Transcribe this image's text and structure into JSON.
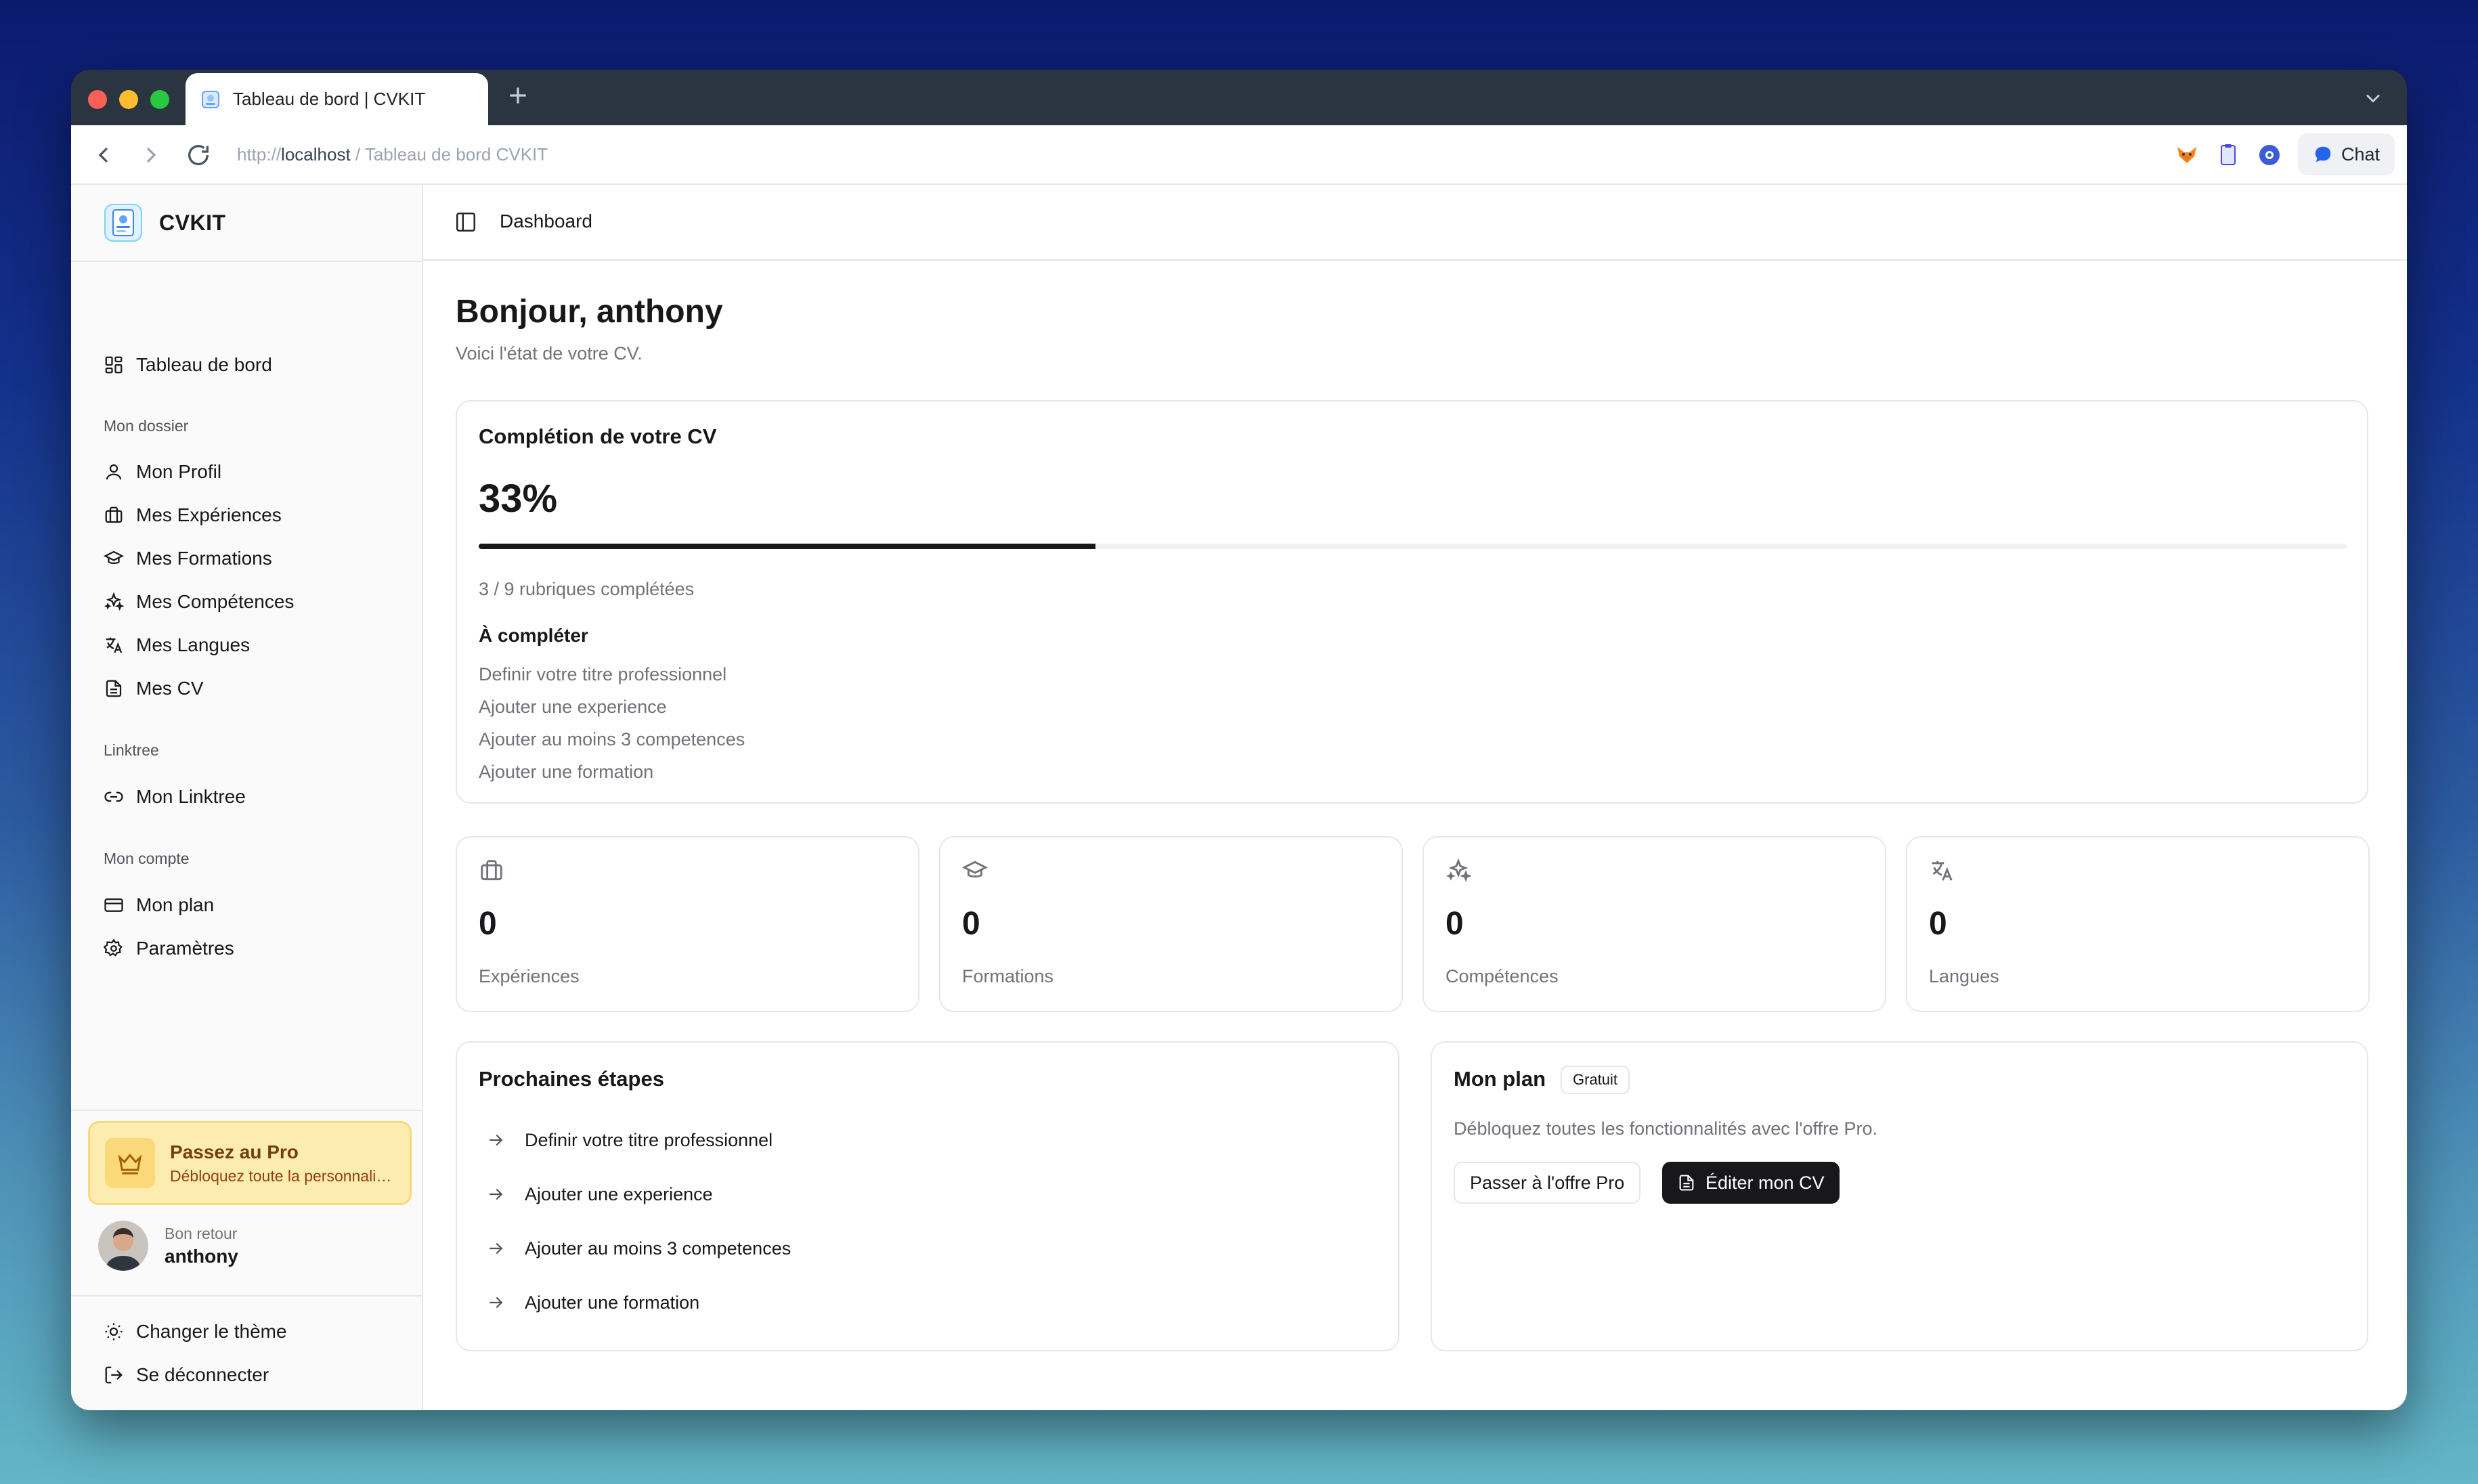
{
  "browser": {
    "tab_title": "Tableau de bord | CVKIT",
    "url_scheme": "http://",
    "url_host": "localhost",
    "url_rest": " / Tableau de bord CVKIT",
    "chat_label": "Chat"
  },
  "sidebar": {
    "brand": "CVKIT",
    "dashboard_label": "Tableau de bord",
    "groups": [
      {
        "title": "Mon dossier",
        "items": [
          {
            "label": "Mon Profil",
            "icon": "user-icon"
          },
          {
            "label": "Mes Expériences",
            "icon": "briefcase-icon"
          },
          {
            "label": "Mes Formations",
            "icon": "graduation-cap-icon"
          },
          {
            "label": "Mes Compétences",
            "icon": "sparkles-icon"
          },
          {
            "label": "Mes Langues",
            "icon": "languages-icon"
          },
          {
            "label": "Mes CV",
            "icon": "file-icon"
          }
        ]
      },
      {
        "title": "Linktree",
        "items": [
          {
            "label": "Mon Linktree",
            "icon": "link-icon"
          }
        ]
      },
      {
        "title": "Mon compte",
        "items": [
          {
            "label": "Mon plan",
            "icon": "credit-card-icon"
          },
          {
            "label": "Paramètres",
            "icon": "gear-icon"
          }
        ]
      }
    ],
    "pro": {
      "title": "Passez au Pro",
      "subtitle": "Débloquez toute la personnalisation"
    },
    "user": {
      "greeting": "Bon retour",
      "name": "anthony"
    },
    "theme_label": "Changer le thème",
    "logout_label": "Se déconnecter"
  },
  "header": {
    "breadcrumb": "Dashboard"
  },
  "main": {
    "greeting": "Bonjour, anthony",
    "subtitle": "Voici l'état de votre CV.",
    "completion": {
      "title": "Complétion de votre CV",
      "percent_label": "33%",
      "percent": 33,
      "count_label": "3 / 9 rubriques complétées",
      "todo_title": "À compléter",
      "todo": [
        "Definir votre titre professionnel",
        "Ajouter une experience",
        "Ajouter au moins 3 competences",
        "Ajouter une formation"
      ]
    },
    "stats": [
      {
        "value": "0",
        "label": "Expériences",
        "icon": "briefcase-icon"
      },
      {
        "value": "0",
        "label": "Formations",
        "icon": "graduation-cap-icon"
      },
      {
        "value": "0",
        "label": "Compétences",
        "icon": "sparkles-icon"
      },
      {
        "value": "0",
        "label": "Langues",
        "icon": "languages-icon"
      }
    ],
    "next_steps": {
      "title": "Prochaines étapes",
      "items": [
        "Definir votre titre professionnel",
        "Ajouter une experience",
        "Ajouter au moins 3 competences",
        "Ajouter une formation"
      ]
    },
    "plan": {
      "title": "Mon plan",
      "badge": "Gratuit",
      "text": "Débloquez toutes les fonctionnalités avec l'offre Pro.",
      "upgrade_label": "Passer à l'offre Pro",
      "edit_label": "Éditer mon CV"
    }
  },
  "colors": {
    "accent": "#18181b",
    "pro_bg": "#fdecb0",
    "muted": "#71717a"
  }
}
